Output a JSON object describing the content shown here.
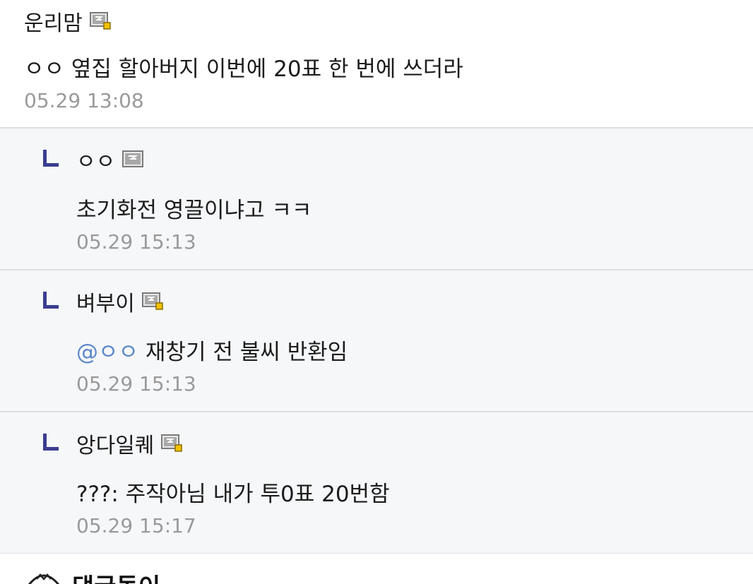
{
  "comments": [
    {
      "nickname": "운리맘",
      "icon": "gallog-fixed-icon",
      "text": "ㅇㅇ 옆집 할아버지 이번에 20표 한 번에 쓰더라",
      "date": "05.29 13:08"
    }
  ],
  "replies": [
    {
      "nickname": "ㅇㅇ",
      "icon": "gallog-icon",
      "text": "초기화전 영끌이냐고 ㅋㅋ",
      "date": "05.29 15:13"
    },
    {
      "nickname": "벼부이",
      "icon": "gallog-fixed-icon",
      "mention": "@ㅇㅇ",
      "text": "재창기 전 불씨 반환임",
      "date": "05.29 15:13"
    },
    {
      "nickname": "앙다일퀘",
      "icon": "gallog-fixed-icon",
      "text": "???: 주작아님 내가 투0표 20번함",
      "date": "05.29 15:17"
    }
  ],
  "footer": {
    "title": "댓글돌이",
    "icon": "bot-icon"
  },
  "colors": {
    "mention": "#5b87c7",
    "reply_bg": "#f6f7f9",
    "reply_mark": "#3a3d8f",
    "date": "#9a9a9a",
    "divider": "#dcdee3"
  }
}
